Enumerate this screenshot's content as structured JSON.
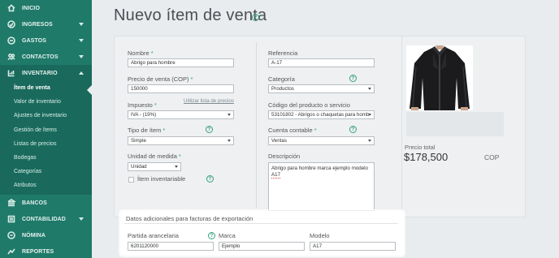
{
  "sidebar": {
    "items": [
      {
        "label": "INICIO",
        "icon": "home-icon"
      },
      {
        "label": "INGRESOS",
        "icon": "income-icon"
      },
      {
        "label": "GASTOS",
        "icon": "expenses-icon"
      },
      {
        "label": "CONTACTOS",
        "icon": "contacts-icon"
      },
      {
        "label": "INVENTARIO",
        "icon": "inventory-icon"
      },
      {
        "label": "BANCOS",
        "icon": "bank-icon"
      },
      {
        "label": "CONTABILIDAD",
        "icon": "accounting-icon"
      },
      {
        "label": "NÓMINA",
        "icon": "payroll-icon"
      },
      {
        "label": "REPORTES",
        "icon": "reports-icon"
      }
    ],
    "inventory_sub": [
      "Ítem de venta",
      "Valor de inventario",
      "Ajustes de inventario",
      "Gestión de ítems",
      "Listas de precios",
      "Bodegas",
      "Categorías",
      "Atributos"
    ]
  },
  "page": {
    "title": "Nuevo ítem de venta",
    "help_glyph": "?"
  },
  "form": {
    "nombre": {
      "label": "Nombre",
      "value": "Abrigo para hombre"
    },
    "precio": {
      "label": "Precio de venta (COP)",
      "value": "150000"
    },
    "impuesto": {
      "label": "Impuesto",
      "value": "IVA - (19%)",
      "link": "Utilizar lista de precios"
    },
    "tipo": {
      "label": "Tipo de ítem",
      "value": "Simple"
    },
    "unidad": {
      "label": "Unidad de medida",
      "value": "Unidad"
    },
    "inventariable": {
      "label": "Ítem inventariable"
    },
    "referencia": {
      "label": "Referencia",
      "value": "A-17"
    },
    "categoria": {
      "label": "Categoría",
      "value": "Productos"
    },
    "codigo": {
      "label": "Código del producto o servicio",
      "value": "53101802 - Abrigos o chaquetas para homb"
    },
    "cuenta": {
      "label": "Cuenta contable",
      "value": "Ventas"
    },
    "descripcion": {
      "label": "Descripción",
      "line1": "Abrigo para hombre marca ejemplo modelo",
      "line2": "A17"
    },
    "required_mark": "*"
  },
  "summary": {
    "total_label": "Precio total",
    "total_value": "$178,500",
    "currency": "COP"
  },
  "export": {
    "title": "Datos adicionales para facturas de exportación",
    "partida": {
      "label": "Partida arancelaria",
      "value": "6201120000"
    },
    "marca": {
      "label": "Marca",
      "value": "Ejemplo"
    },
    "modelo": {
      "label": "Modelo",
      "value": "A17"
    }
  },
  "colors": {
    "sidebar": "#1f7a6a",
    "accent": "#35a07f"
  }
}
